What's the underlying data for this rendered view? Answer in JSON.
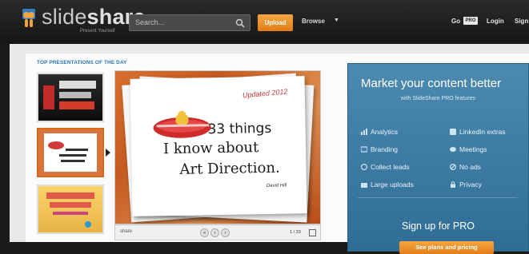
{
  "header": {
    "logo_text_1": "slide",
    "logo_text_2": "share",
    "logo_tagline": "Present Yourself",
    "search_placeholder": "Search...",
    "upload_label": "Upload",
    "browse_label": "Browse",
    "go_label": "Go",
    "pro_badge": "PRO",
    "login_label": "Login",
    "signup_label": "Sign"
  },
  "main": {
    "section_title": "TOP PRESENTATIONS OF THE DAY",
    "slide": {
      "update_text": "Updated 2012",
      "line1": "33 things",
      "line2": "I know about",
      "line3": "Art Direction.",
      "author": "David Hill"
    },
    "player": {
      "share_label": "share",
      "page_count": "1 / 33"
    }
  },
  "promo": {
    "title": "Market your content better",
    "subtitle": "with SlideShare PRO features",
    "features": [
      "Analytics",
      "LinkedIn extras",
      "Branding",
      "Meetings",
      "Collect leads",
      "No ads",
      "Large uploads",
      "Privacy"
    ],
    "cta_heading": "Sign up for PRO",
    "cta_button": "See plans and pricing"
  },
  "colors": {
    "accent": "#e98a20",
    "link_blue": "#2d74b8",
    "promo_blue": "#3c7ca6"
  }
}
